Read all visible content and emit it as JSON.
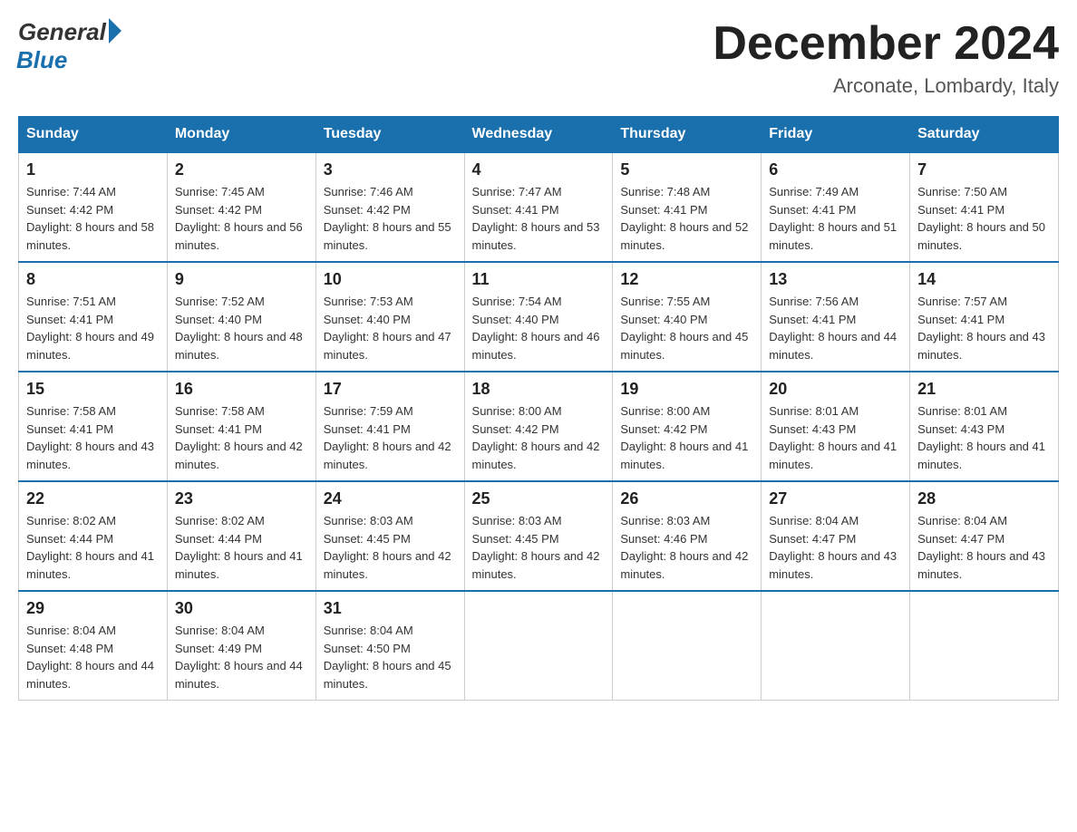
{
  "header": {
    "logo_general": "General",
    "logo_blue": "Blue",
    "month_title": "December 2024",
    "location": "Arconate, Lombardy, Italy"
  },
  "days_of_week": [
    "Sunday",
    "Monday",
    "Tuesday",
    "Wednesday",
    "Thursday",
    "Friday",
    "Saturday"
  ],
  "weeks": [
    [
      {
        "day": "1",
        "sunrise": "7:44 AM",
        "sunset": "4:42 PM",
        "daylight": "8 hours and 58 minutes."
      },
      {
        "day": "2",
        "sunrise": "7:45 AM",
        "sunset": "4:42 PM",
        "daylight": "8 hours and 56 minutes."
      },
      {
        "day": "3",
        "sunrise": "7:46 AM",
        "sunset": "4:42 PM",
        "daylight": "8 hours and 55 minutes."
      },
      {
        "day": "4",
        "sunrise": "7:47 AM",
        "sunset": "4:41 PM",
        "daylight": "8 hours and 53 minutes."
      },
      {
        "day": "5",
        "sunrise": "7:48 AM",
        "sunset": "4:41 PM",
        "daylight": "8 hours and 52 minutes."
      },
      {
        "day": "6",
        "sunrise": "7:49 AM",
        "sunset": "4:41 PM",
        "daylight": "8 hours and 51 minutes."
      },
      {
        "day": "7",
        "sunrise": "7:50 AM",
        "sunset": "4:41 PM",
        "daylight": "8 hours and 50 minutes."
      }
    ],
    [
      {
        "day": "8",
        "sunrise": "7:51 AM",
        "sunset": "4:41 PM",
        "daylight": "8 hours and 49 minutes."
      },
      {
        "day": "9",
        "sunrise": "7:52 AM",
        "sunset": "4:40 PM",
        "daylight": "8 hours and 48 minutes."
      },
      {
        "day": "10",
        "sunrise": "7:53 AM",
        "sunset": "4:40 PM",
        "daylight": "8 hours and 47 minutes."
      },
      {
        "day": "11",
        "sunrise": "7:54 AM",
        "sunset": "4:40 PM",
        "daylight": "8 hours and 46 minutes."
      },
      {
        "day": "12",
        "sunrise": "7:55 AM",
        "sunset": "4:40 PM",
        "daylight": "8 hours and 45 minutes."
      },
      {
        "day": "13",
        "sunrise": "7:56 AM",
        "sunset": "4:41 PM",
        "daylight": "8 hours and 44 minutes."
      },
      {
        "day": "14",
        "sunrise": "7:57 AM",
        "sunset": "4:41 PM",
        "daylight": "8 hours and 43 minutes."
      }
    ],
    [
      {
        "day": "15",
        "sunrise": "7:58 AM",
        "sunset": "4:41 PM",
        "daylight": "8 hours and 43 minutes."
      },
      {
        "day": "16",
        "sunrise": "7:58 AM",
        "sunset": "4:41 PM",
        "daylight": "8 hours and 42 minutes."
      },
      {
        "day": "17",
        "sunrise": "7:59 AM",
        "sunset": "4:41 PM",
        "daylight": "8 hours and 42 minutes."
      },
      {
        "day": "18",
        "sunrise": "8:00 AM",
        "sunset": "4:42 PM",
        "daylight": "8 hours and 42 minutes."
      },
      {
        "day": "19",
        "sunrise": "8:00 AM",
        "sunset": "4:42 PM",
        "daylight": "8 hours and 41 minutes."
      },
      {
        "day": "20",
        "sunrise": "8:01 AM",
        "sunset": "4:43 PM",
        "daylight": "8 hours and 41 minutes."
      },
      {
        "day": "21",
        "sunrise": "8:01 AM",
        "sunset": "4:43 PM",
        "daylight": "8 hours and 41 minutes."
      }
    ],
    [
      {
        "day": "22",
        "sunrise": "8:02 AM",
        "sunset": "4:44 PM",
        "daylight": "8 hours and 41 minutes."
      },
      {
        "day": "23",
        "sunrise": "8:02 AM",
        "sunset": "4:44 PM",
        "daylight": "8 hours and 41 minutes."
      },
      {
        "day": "24",
        "sunrise": "8:03 AM",
        "sunset": "4:45 PM",
        "daylight": "8 hours and 42 minutes."
      },
      {
        "day": "25",
        "sunrise": "8:03 AM",
        "sunset": "4:45 PM",
        "daylight": "8 hours and 42 minutes."
      },
      {
        "day": "26",
        "sunrise": "8:03 AM",
        "sunset": "4:46 PM",
        "daylight": "8 hours and 42 minutes."
      },
      {
        "day": "27",
        "sunrise": "8:04 AM",
        "sunset": "4:47 PM",
        "daylight": "8 hours and 43 minutes."
      },
      {
        "day": "28",
        "sunrise": "8:04 AM",
        "sunset": "4:47 PM",
        "daylight": "8 hours and 43 minutes."
      }
    ],
    [
      {
        "day": "29",
        "sunrise": "8:04 AM",
        "sunset": "4:48 PM",
        "daylight": "8 hours and 44 minutes."
      },
      {
        "day": "30",
        "sunrise": "8:04 AM",
        "sunset": "4:49 PM",
        "daylight": "8 hours and 44 minutes."
      },
      {
        "day": "31",
        "sunrise": "8:04 AM",
        "sunset": "4:50 PM",
        "daylight": "8 hours and 45 minutes."
      },
      null,
      null,
      null,
      null
    ]
  ]
}
